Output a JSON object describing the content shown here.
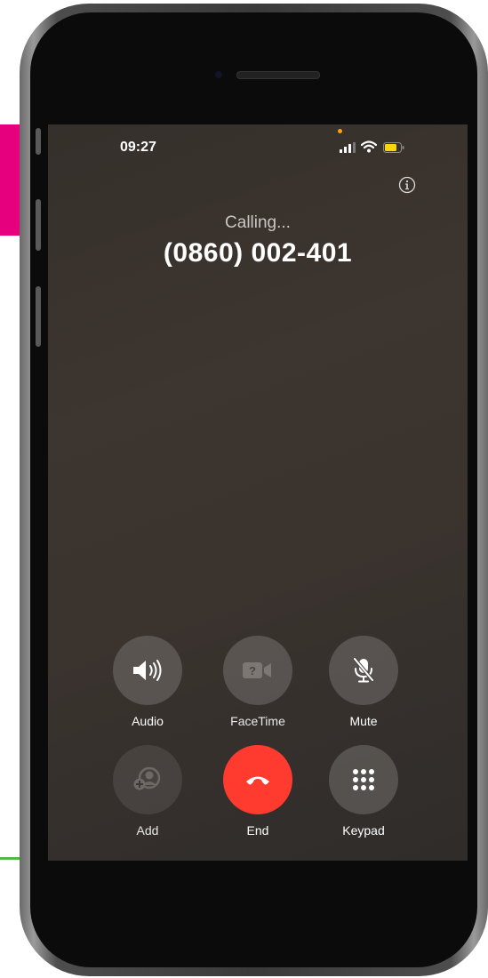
{
  "status_bar": {
    "time": "09:27"
  },
  "call": {
    "status": "Calling...",
    "number": "(0860) 002-401"
  },
  "controls": [
    {
      "label": "Audio",
      "icon": "speaker-icon"
    },
    {
      "label": "FaceTime",
      "icon": "video-camera-icon"
    },
    {
      "label": "Mute",
      "icon": "mic-off-icon"
    },
    {
      "label": "Add",
      "icon": "add-person-icon"
    },
    {
      "label": "End",
      "icon": "phone-hangup-icon"
    },
    {
      "label": "Keypad",
      "icon": "keypad-icon"
    }
  ],
  "colors": {
    "end_call": "#ff3b30",
    "recording_dot": "#ff9f0a",
    "battery": "#ffd60a",
    "accent_pink": "#e6007e",
    "accent_green": "#52b848"
  }
}
